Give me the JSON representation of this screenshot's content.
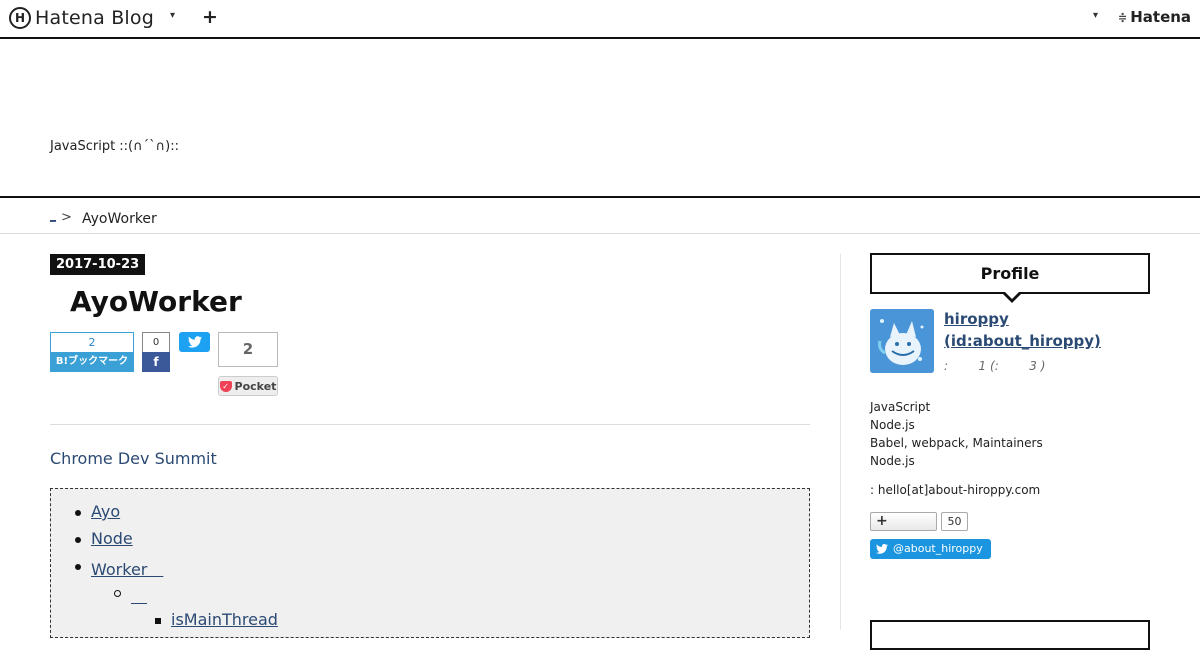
{
  "global_header": {
    "logo_mark": "H",
    "logo_text": "Hatena Blog",
    "menu_caret": "▾",
    "add_icon": "+",
    "right_caret": "▾",
    "hatena_mark": "≑",
    "hatena_text": "Hatena"
  },
  "blog": {
    "description": "JavaScript ::(∩´`∩)::"
  },
  "breadcrumb": {
    "home": "_",
    "separator": ">",
    "current": "AyoWorker"
  },
  "entry": {
    "date": "2017-10-23",
    "title": "AyoWorker",
    "share": {
      "hatena_count": "2",
      "hatena_label": "B!ブックマーク",
      "facebook_count": "0",
      "facebook_label": "f",
      "twitter_label": "t",
      "pocket_count": "2",
      "pocket_label": "Pocket"
    },
    "intro_link": "Chrome Dev Summit",
    "toc": [
      {
        "label": "Ayo",
        "level": 1
      },
      {
        "label": "Node",
        "level": 1
      },
      {
        "label": "Worker　",
        "level": 1
      },
      {
        "label": "　",
        "level": 2
      },
      {
        "label": "isMainThread",
        "level": 3
      }
    ]
  },
  "sidebar": {
    "profile": {
      "heading": "Profile",
      "name": "hiroppy",
      "id": "(id:about_hiroppy)",
      "meta": ":        1 (:        3 )",
      "description": [
        "JavaScript",
        "Node.js",
        "Babel, webpack, Maintainers",
        "Node.js"
      ],
      "contact": ": hello[at]about-hiroppy.com",
      "follow_icon": "+",
      "follow_count": "50",
      "twitter_handle": "@about_hiroppy"
    }
  },
  "colors": {
    "link": "#2b4a73",
    "hatena_bookmark": "#3aa0d6",
    "facebook": "#3b5998",
    "twitter": "#1da1f2",
    "pocket": "#ee4056"
  }
}
